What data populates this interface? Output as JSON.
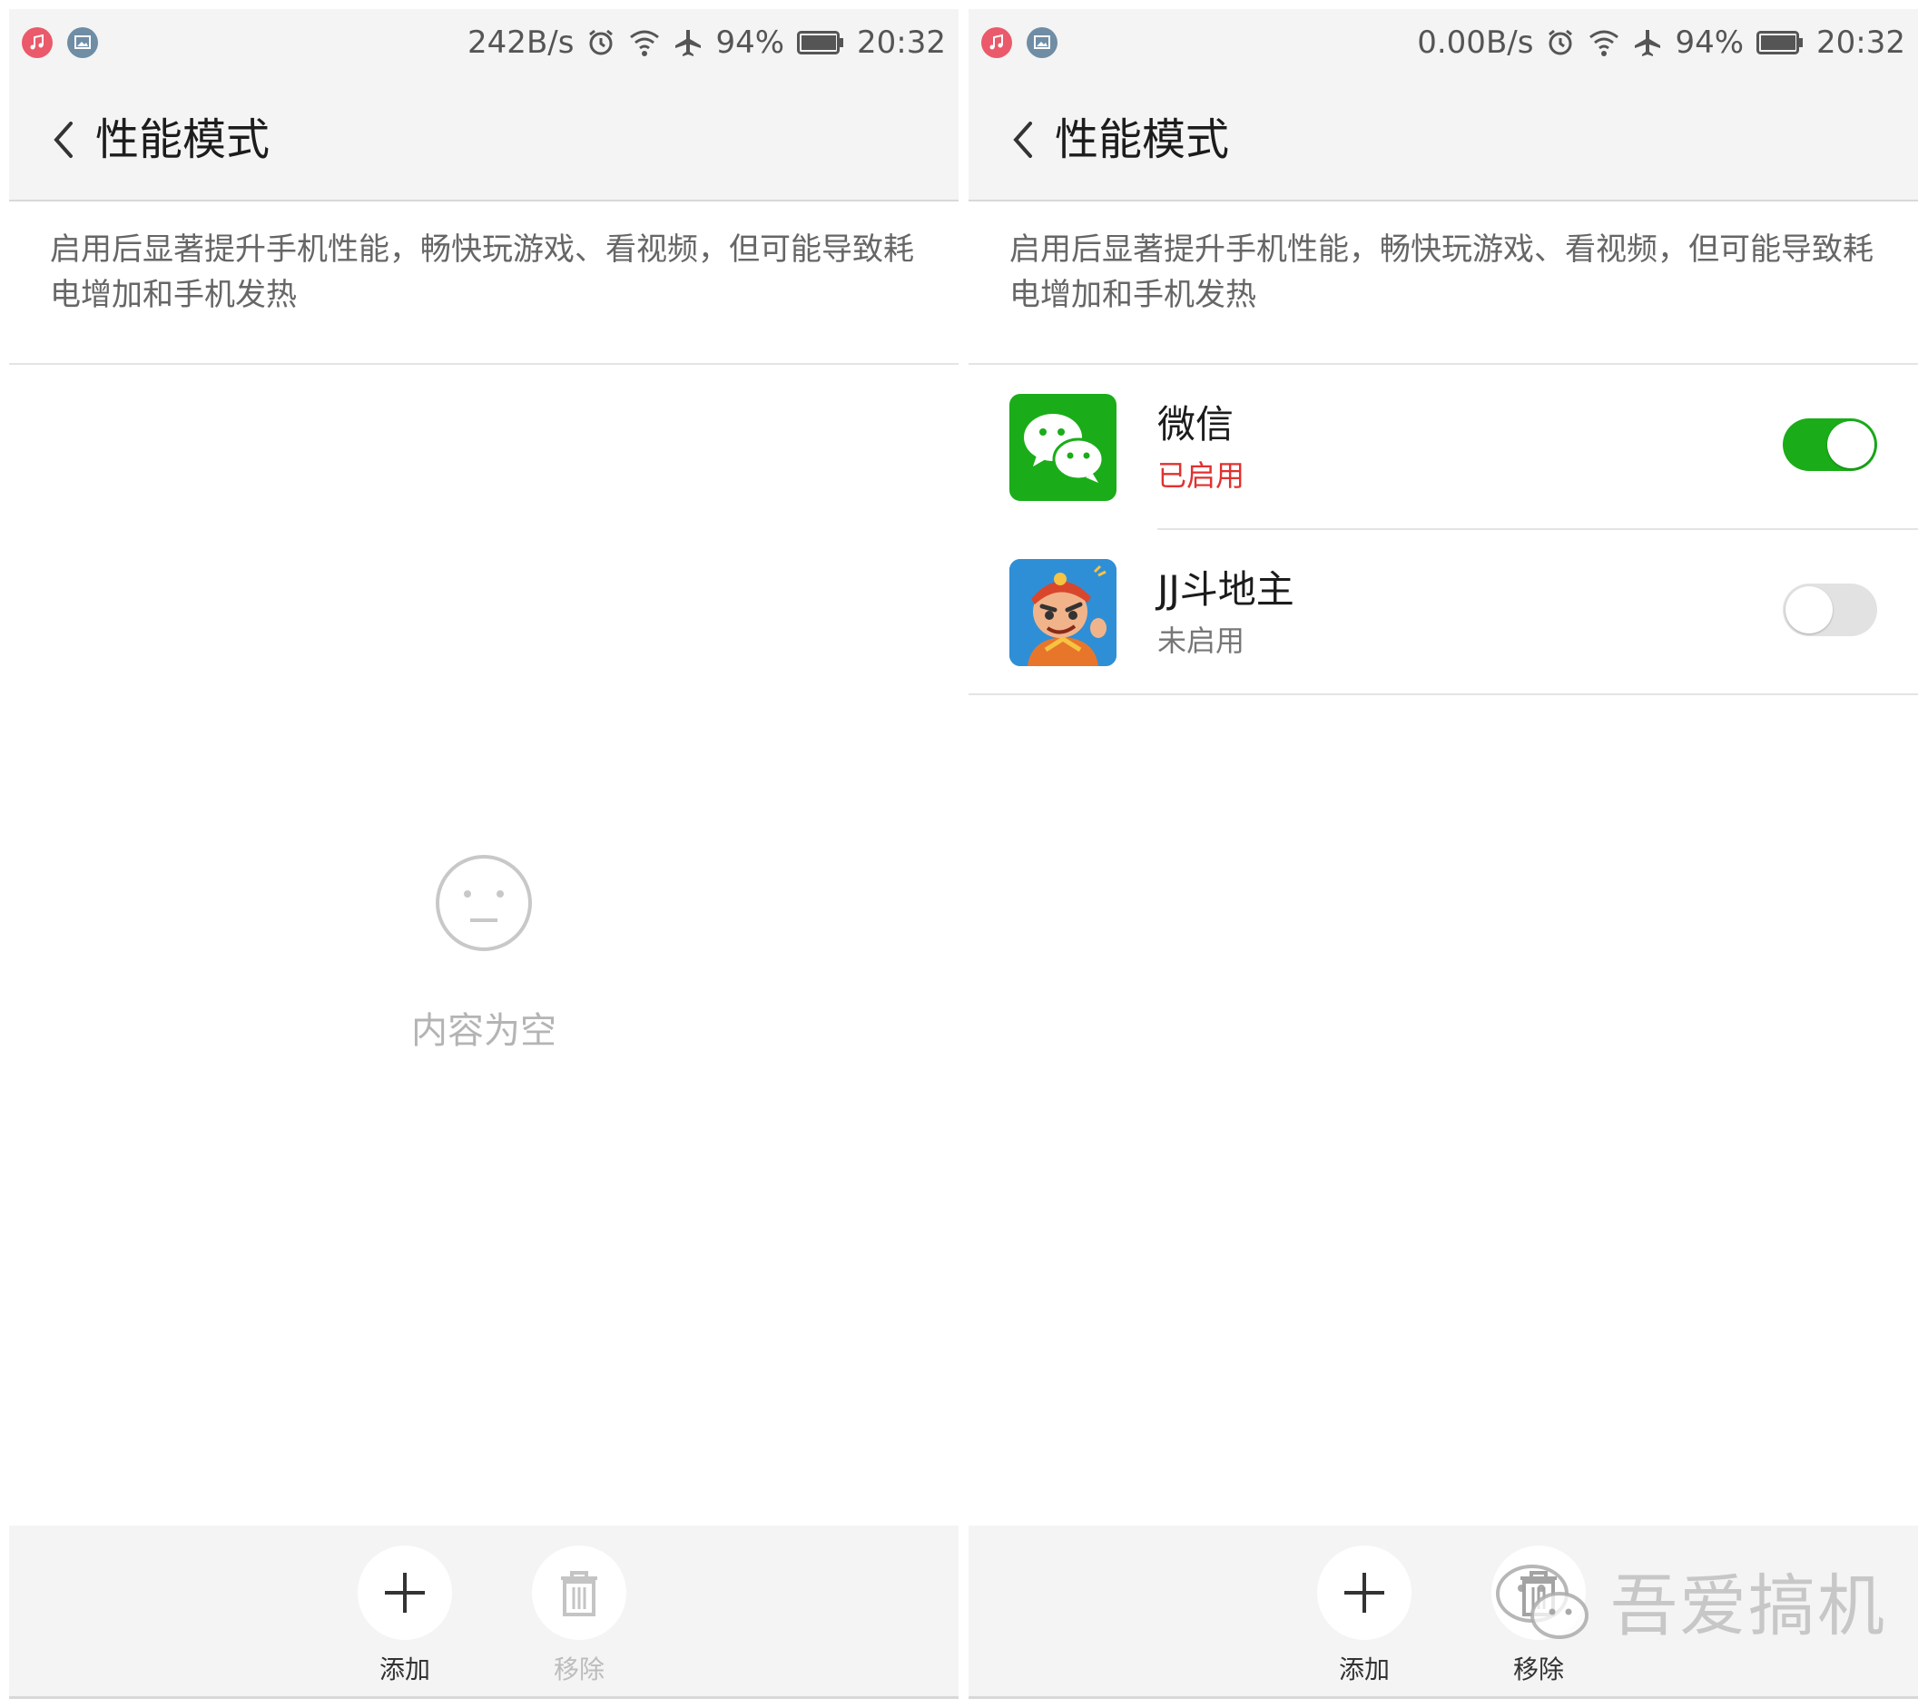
{
  "left": {
    "status": {
      "speed": "242B/s",
      "battery": "94%",
      "time": "20:32"
    },
    "header": {
      "title": "性能模式"
    },
    "description": "启用后显著提升手机性能，畅快玩游戏、看视频，但可能导致耗电增加和手机发热",
    "empty_text": "内容为空",
    "actions": {
      "add_label": "添加",
      "remove_label": "移除"
    }
  },
  "right": {
    "status": {
      "speed": "0.00B/s",
      "battery": "94%",
      "time": "20:32"
    },
    "header": {
      "title": "性能模式"
    },
    "description": "启用后显著提升手机性能，畅快玩游戏、看视频，但可能导致耗电增加和手机发热",
    "apps": [
      {
        "name": "微信",
        "status": "已启用",
        "enabled": true,
        "icon": "wechat-app-icon"
      },
      {
        "name": "JJ斗地主",
        "status": "未启用",
        "enabled": false,
        "icon": "jj-doudizhu-app-icon"
      }
    ],
    "actions": {
      "add_label": "添加",
      "remove_label": "移除"
    }
  },
  "watermark": {
    "text": "吾爱搞机"
  },
  "colors": {
    "accent_green": "#1aac19",
    "enabled_red": "#e0312f",
    "bar_bg": "#f4f4f4"
  }
}
